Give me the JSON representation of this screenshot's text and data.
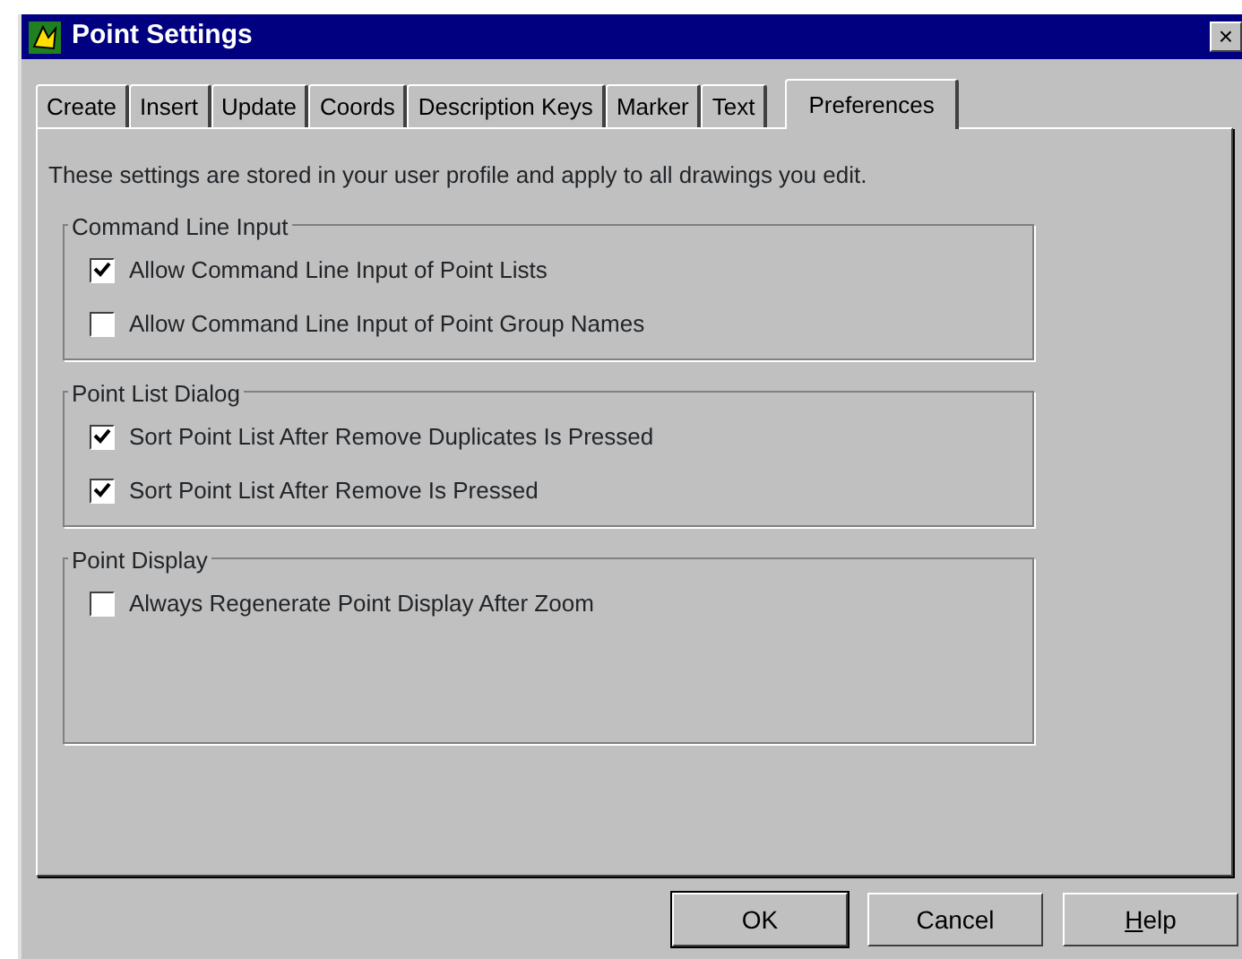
{
  "window": {
    "title": "Point Settings",
    "close": "×"
  },
  "tabs": [
    {
      "label": "Create",
      "selected": false
    },
    {
      "label": "Insert",
      "selected": false
    },
    {
      "label": "Update",
      "selected": false
    },
    {
      "label": "Coords",
      "selected": false
    },
    {
      "label": "Description Keys",
      "selected": false
    },
    {
      "label": "Marker",
      "selected": false
    },
    {
      "label": "Text",
      "selected": false
    },
    {
      "label": "Preferences",
      "selected": true
    }
  ],
  "intro": "These settings are stored in your user profile and apply to all drawings you edit.",
  "groups": [
    {
      "title": "Command Line Input",
      "options": [
        {
          "label": "Allow Command Line Input of Point Lists",
          "checked": true
        },
        {
          "label": "Allow Command Line Input of Point Group Names",
          "checked": false
        }
      ]
    },
    {
      "title": "Point List Dialog",
      "options": [
        {
          "label": "Sort Point List After Remove Duplicates Is Pressed",
          "checked": true
        },
        {
          "label": "Sort Point List After Remove Is Pressed",
          "checked": true
        }
      ]
    },
    {
      "title": "Point Display",
      "options": [
        {
          "label": "Always Regenerate Point Display After Zoom",
          "checked": false
        }
      ]
    }
  ],
  "buttons": [
    {
      "label": "OK",
      "default": true,
      "underline_first": false
    },
    {
      "label": "Cancel",
      "default": false,
      "underline_first": false
    },
    {
      "label": "Help",
      "default": false,
      "underline_first": true
    }
  ]
}
